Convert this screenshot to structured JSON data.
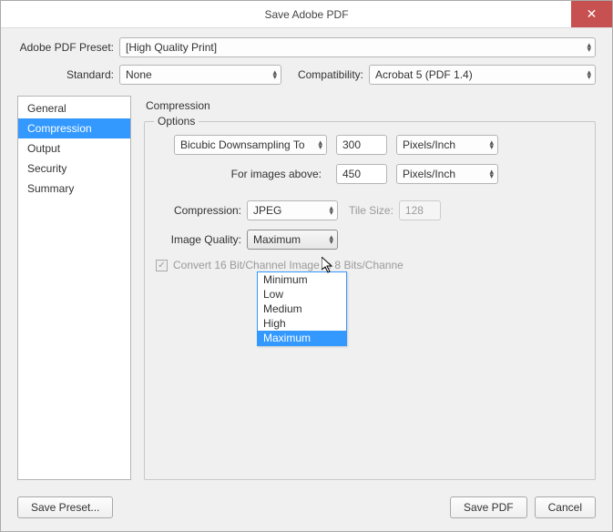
{
  "window": {
    "title": "Save Adobe PDF"
  },
  "preset": {
    "label": "Adobe PDF Preset:",
    "value": "[High Quality Print]"
  },
  "standard": {
    "label": "Standard:",
    "value": "None"
  },
  "compatibility": {
    "label": "Compatibility:",
    "value": "Acrobat 5 (PDF 1.4)"
  },
  "sidebar": {
    "items": [
      {
        "label": "General"
      },
      {
        "label": "Compression"
      },
      {
        "label": "Output"
      },
      {
        "label": "Security"
      },
      {
        "label": "Summary"
      }
    ]
  },
  "panel": {
    "title": "Compression",
    "optionsLegend": "Options",
    "downsample": {
      "method": "Bicubic Downsampling To",
      "value": "300",
      "unit": "Pixels/Inch"
    },
    "forAbove": {
      "label": "For images above:",
      "value": "450",
      "unit": "Pixels/Inch"
    },
    "compression": {
      "label": "Compression:",
      "value": "JPEG"
    },
    "tileSize": {
      "label": "Tile Size:",
      "value": "128"
    },
    "imageQuality": {
      "label": "Image Quality:",
      "value": "Maximum"
    },
    "convert": {
      "label": "Convert 16 Bit/Channel Image to 8 Bits/Channe"
    }
  },
  "dropdown": {
    "items": [
      "Minimum",
      "Low",
      "Medium",
      "High",
      "Maximum"
    ],
    "highlighted": "Maximum"
  },
  "footer": {
    "savePreset": "Save Preset...",
    "savePdf": "Save PDF",
    "cancel": "Cancel"
  }
}
